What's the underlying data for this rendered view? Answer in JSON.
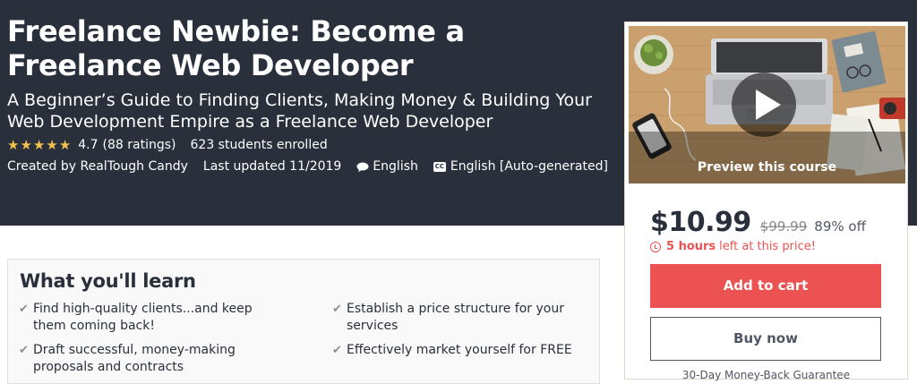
{
  "course": {
    "title": "Freelance Newbie: Become a Freelance Web Developer",
    "subtitle": "A Beginner’s Guide to Finding Clients, Making Money & Building Your Web Development Empire as a Freelance Web Developer",
    "rating_value": "4.7",
    "rating_count": "(88 ratings)",
    "rating_stars": 5,
    "students": "623 students enrolled",
    "created_by": "Created by RealTough Candy",
    "last_updated": "Last updated 11/2019",
    "language": "English",
    "captions": "English [Auto-generated]"
  },
  "learn": {
    "title": "What you'll learn",
    "items": [
      "Find high-quality clients...and keep them coming back!",
      "Establish a price structure for your services",
      "Draft successful, money-making proposals and contracts",
      "Effectively market yourself for FREE"
    ]
  },
  "sidebar": {
    "preview_label": "Preview this course",
    "price": "$10.99",
    "old_price": "$99.99",
    "discount": "89% off",
    "timer_bold": "5 hours",
    "timer_rest": "left at this price!",
    "add_to_cart": "Add to cart",
    "buy_now": "Buy now",
    "guarantee": "30-Day Money-Back Guarantee"
  },
  "colors": {
    "hero_bg": "#29303b",
    "star": "#f4c150",
    "accent_red": "#ec5252"
  }
}
